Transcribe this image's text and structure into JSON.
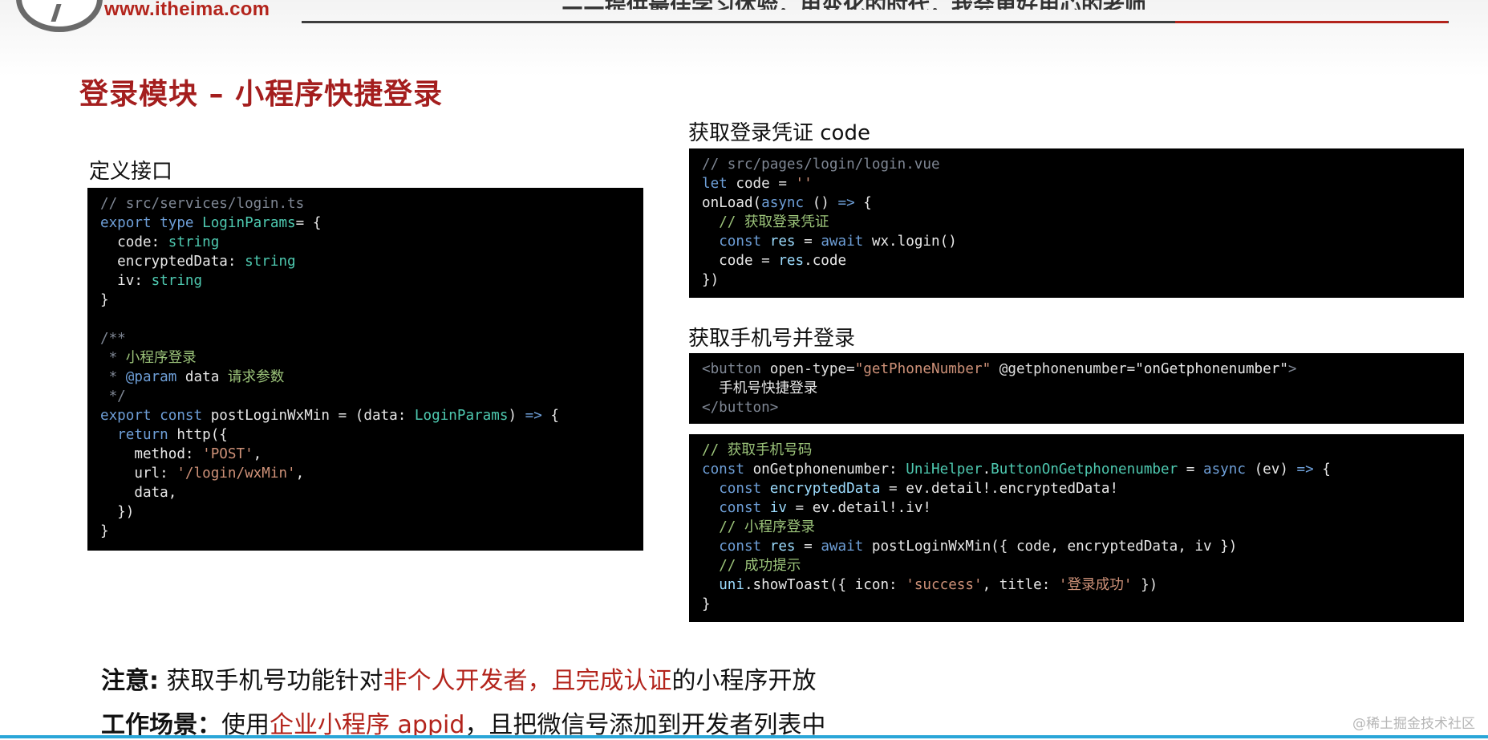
{
  "header": {
    "site_url": "www.itheima.com",
    "banner_text": "——提供最佳学习体验，用变化的时代，我会更好用心的老师"
  },
  "title": "登录模块 – 小程序快捷登录",
  "sections": {
    "define_api": "定义接口",
    "get_code": "获取登录凭证 code",
    "get_phone": "获取手机号并登录"
  },
  "code_blocks": {
    "login_service": [
      [
        [
          "c-com",
          "// src/services/login.ts"
        ]
      ],
      [
        [
          "c-kw",
          "export type "
        ],
        [
          "c-type",
          "LoginParams"
        ],
        [
          "",
          "= {"
        ]
      ],
      [
        [
          "",
          "  code: "
        ],
        [
          "c-type",
          "string"
        ]
      ],
      [
        [
          "",
          "  encryptedData: "
        ],
        [
          "c-type",
          "string"
        ]
      ],
      [
        [
          "",
          "  iv: "
        ],
        [
          "c-type",
          "string"
        ]
      ],
      [
        [
          "",
          "}"
        ]
      ],
      [
        [
          "",
          ""
        ]
      ],
      [
        [
          "c-com",
          "/**"
        ]
      ],
      [
        [
          "c-com",
          " * "
        ],
        [
          "c-grn",
          "小程序登录"
        ]
      ],
      [
        [
          "c-com",
          " * "
        ],
        [
          "c-kw",
          "@param"
        ],
        [
          "",
          " data "
        ],
        [
          "c-grn",
          "请求参数"
        ]
      ],
      [
        [
          "c-com",
          " */"
        ]
      ],
      [
        [
          "c-kw",
          "export const "
        ],
        [
          "",
          "postLoginWxMin = (data: "
        ],
        [
          "c-type",
          "LoginParams"
        ],
        [
          "",
          ") "
        ],
        [
          "c-kw",
          "=>"
        ],
        [
          "",
          " {"
        ]
      ],
      [
        [
          "",
          "  "
        ],
        [
          "c-kw",
          "return "
        ],
        [
          "",
          "http({"
        ]
      ],
      [
        [
          "",
          "    method: "
        ],
        [
          "c-str",
          "'POST'"
        ],
        [
          "",
          ","
        ]
      ],
      [
        [
          "",
          "    url: "
        ],
        [
          "c-str",
          "'/login/wxMin'"
        ],
        [
          "",
          ","
        ]
      ],
      [
        [
          "",
          "    data,"
        ]
      ],
      [
        [
          "",
          "  })"
        ]
      ],
      [
        [
          "",
          "}"
        ]
      ]
    ],
    "login_vue": [
      [
        [
          "c-com",
          "// src/pages/login/login.vue"
        ]
      ],
      [
        [
          "c-kw",
          "let "
        ],
        [
          "",
          "code = "
        ],
        [
          "c-str",
          "''"
        ]
      ],
      [
        [
          "",
          "onLoad("
        ],
        [
          "c-kw",
          "async "
        ],
        [
          "",
          "() "
        ],
        [
          "c-kw",
          "=>"
        ],
        [
          "",
          " {"
        ]
      ],
      [
        [
          "",
          "  "
        ],
        [
          "c-grn",
          "// 获取登录凭证"
        ]
      ],
      [
        [
          "",
          "  "
        ],
        [
          "c-kw",
          "const "
        ],
        [
          "c-id",
          "res"
        ],
        [
          "",
          " = "
        ],
        [
          "c-kw",
          "await "
        ],
        [
          "",
          "wx.login()"
        ]
      ],
      [
        [
          "",
          "  code = "
        ],
        [
          "c-id",
          "res"
        ],
        [
          "",
          ".code"
        ]
      ],
      [
        [
          "",
          "})"
        ]
      ]
    ],
    "button_tpl": [
      [
        [
          "c-tag",
          "<button "
        ],
        [
          "c-attr",
          "open-type"
        ],
        [
          "",
          "="
        ],
        [
          "c-str",
          "\"getPhoneNumber\""
        ],
        [
          "",
          " "
        ],
        [
          "c-attr",
          "@getphonenumber"
        ],
        [
          "",
          "="
        ],
        [
          "",
          "\"onGetphonenumber\""
        ],
        [
          "c-tag",
          ">"
        ]
      ],
      [
        [
          "",
          "  手机号快捷登录"
        ]
      ],
      [
        [
          "c-tag",
          "</button>"
        ]
      ]
    ],
    "phone_handler": [
      [
        [
          "c-grn",
          "// 获取手机号码"
        ]
      ],
      [
        [
          "c-kw",
          "const "
        ],
        [
          "",
          "onGetphonenumber: "
        ],
        [
          "c-type",
          "UniHelper"
        ],
        [
          "",
          "."
        ],
        [
          "c-type",
          "ButtonOnGetphonenumber"
        ],
        [
          "",
          " = "
        ],
        [
          "c-kw",
          "async "
        ],
        [
          "",
          "(ev) "
        ],
        [
          "c-kw",
          "=>"
        ],
        [
          "",
          " {"
        ]
      ],
      [
        [
          "",
          "  "
        ],
        [
          "c-kw",
          "const "
        ],
        [
          "c-id",
          "encryptedData"
        ],
        [
          "",
          " = ev.detail!.encryptedData!"
        ]
      ],
      [
        [
          "",
          "  "
        ],
        [
          "c-kw",
          "const "
        ],
        [
          "c-id",
          "iv"
        ],
        [
          "",
          " = ev.detail!.iv!"
        ]
      ],
      [
        [
          "",
          "  "
        ],
        [
          "c-grn",
          "// 小程序登录"
        ]
      ],
      [
        [
          "",
          "  "
        ],
        [
          "c-kw",
          "const "
        ],
        [
          "c-id",
          "res"
        ],
        [
          "",
          " = "
        ],
        [
          "c-kw",
          "await "
        ],
        [
          "",
          "postLoginWxMin({ code, encryptedData, iv })"
        ]
      ],
      [
        [
          "",
          "  "
        ],
        [
          "c-grn",
          "// 成功提示"
        ]
      ],
      [
        [
          "",
          "  "
        ],
        [
          "c-id",
          "uni"
        ],
        [
          "",
          ".showToast({ icon: "
        ],
        [
          "c-str",
          "'success'"
        ],
        [
          "",
          ", title: "
        ],
        [
          "c-str",
          "'登录成功'"
        ],
        [
          "",
          " })"
        ]
      ],
      [
        [
          "",
          "}"
        ]
      ]
    ]
  },
  "notes": {
    "note1_label": "注意:",
    "note1_text_a": "获取手机号功能针对",
    "note1_highlight": "非个人开发者，且完成认证",
    "note1_text_b": "的小程序开放",
    "note2_label": "工作场景：",
    "note2_text_a": "使用",
    "note2_highlight": "企业小程序 appid",
    "note2_text_b": "，且把微信号添加到开发者列表中"
  },
  "watermark": "@稀土掘金技术社区",
  "colors": {
    "title_red": "#a41e1e",
    "accent_red": "#b3241c",
    "code_bg": "#000000"
  }
}
